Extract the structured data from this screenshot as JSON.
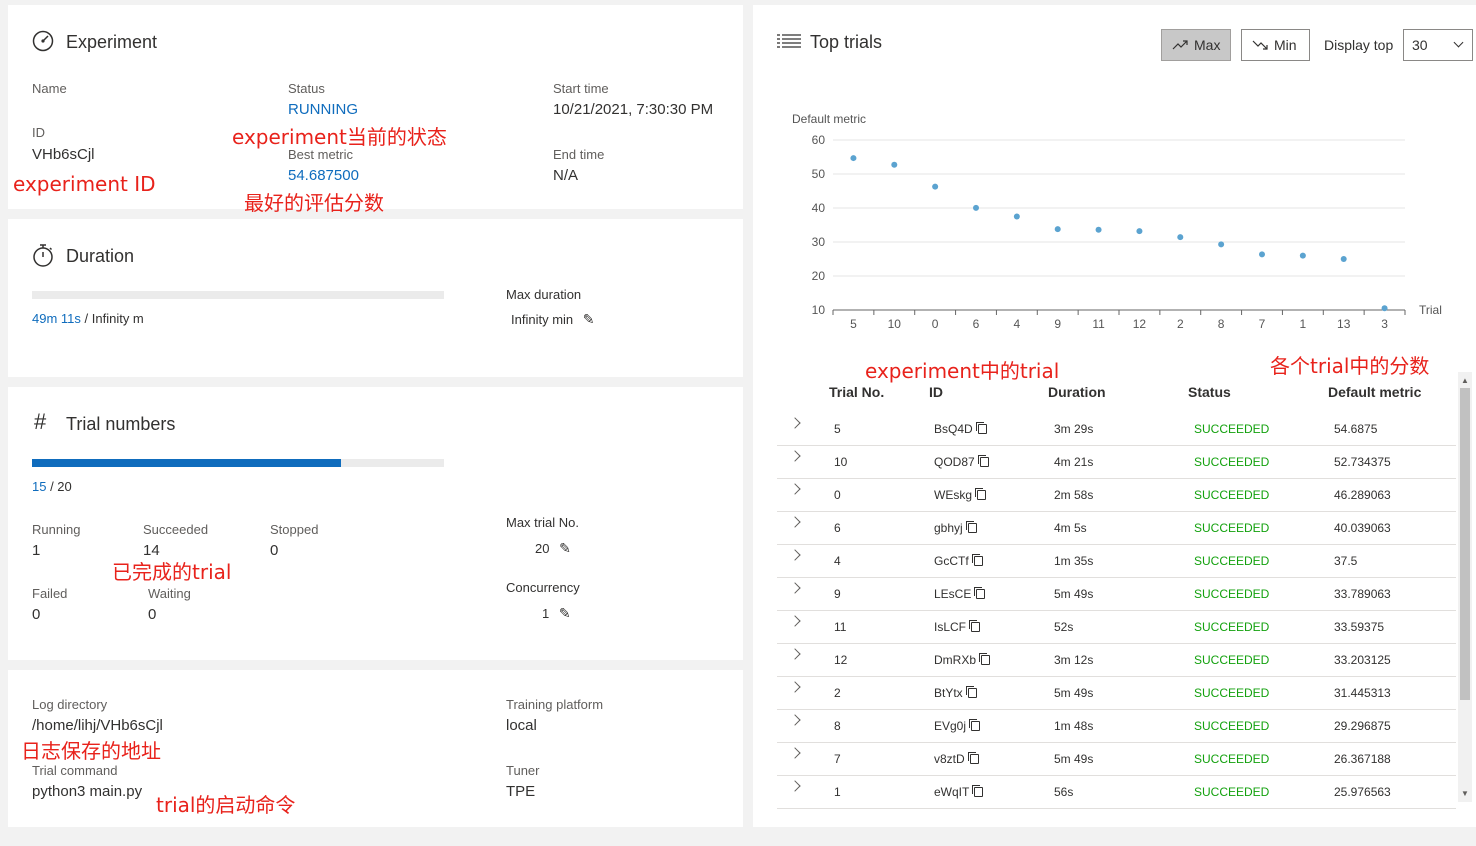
{
  "experiment": {
    "title": "Experiment",
    "name_label": "Name",
    "id_label": "ID",
    "id_value": "VHb6sCjl",
    "status_label": "Status",
    "status_value": "RUNNING",
    "best_metric_label": "Best metric",
    "best_metric_value": "54.687500",
    "start_time_label": "Start time",
    "start_time_value": "10/21/2021, 7:30:30 PM",
    "end_time_label": "End time",
    "end_time_value": "N/A"
  },
  "duration": {
    "title": "Duration",
    "elapsed": "49m 11s",
    "total": " / Infinity m",
    "progress_fraction": 0,
    "max_label": "Max duration",
    "max_value": "Infinity",
    "max_unit": "min"
  },
  "trial_numbers": {
    "title": "Trial numbers",
    "done": "15",
    "total": " / 20",
    "progress_fraction": 0.75,
    "running_label": "Running",
    "running_value": "1",
    "succeeded_label": "Succeeded",
    "succeeded_value": "14",
    "stopped_label": "Stopped",
    "stopped_value": "0",
    "failed_label": "Failed",
    "failed_value": "0",
    "waiting_label": "Waiting",
    "waiting_value": "0",
    "max_trial_label": "Max trial No.",
    "max_trial_value": "20",
    "concurrency_label": "Concurrency",
    "concurrency_value": "1"
  },
  "info": {
    "log_dir_label": "Log directory",
    "log_dir_value": "/home/lihj/VHb6sCjl",
    "trial_cmd_label": "Trial command",
    "trial_cmd_value": "python3 main.py",
    "platform_label": "Training platform",
    "platform_value": "local",
    "tuner_label": "Tuner",
    "tuner_value": "TPE"
  },
  "top_trials": {
    "title": "Top trials",
    "max_label": "Max",
    "min_label": "Min",
    "display_top_label": "Display top",
    "display_top_value": "30",
    "columns": [
      "Trial No.",
      "ID",
      "Duration",
      "Status",
      "Default metric"
    ],
    "rows": [
      {
        "no": "5",
        "id": "BsQ4D",
        "duration": "3m 29s",
        "status": "SUCCEEDED",
        "metric": "54.6875"
      },
      {
        "no": "10",
        "id": "QOD87",
        "duration": "4m 21s",
        "status": "SUCCEEDED",
        "metric": "52.734375"
      },
      {
        "no": "0",
        "id": "WEskg",
        "duration": "2m 58s",
        "status": "SUCCEEDED",
        "metric": "46.289063"
      },
      {
        "no": "6",
        "id": "gbhyj",
        "duration": "4m 5s",
        "status": "SUCCEEDED",
        "metric": "40.039063"
      },
      {
        "no": "4",
        "id": "GcCTf",
        "duration": "1m 35s",
        "status": "SUCCEEDED",
        "metric": "37.5"
      },
      {
        "no": "9",
        "id": "LEsCE",
        "duration": "5m 49s",
        "status": "SUCCEEDED",
        "metric": "33.789063"
      },
      {
        "no": "11",
        "id": "IsLCF",
        "duration": "52s",
        "status": "SUCCEEDED",
        "metric": "33.59375"
      },
      {
        "no": "12",
        "id": "DmRXb",
        "duration": "3m 12s",
        "status": "SUCCEEDED",
        "metric": "33.203125"
      },
      {
        "no": "2",
        "id": "BtYtx",
        "duration": "5m 49s",
        "status": "SUCCEEDED",
        "metric": "31.445313"
      },
      {
        "no": "8",
        "id": "EVg0j",
        "duration": "1m 48s",
        "status": "SUCCEEDED",
        "metric": "29.296875"
      },
      {
        "no": "7",
        "id": "v8ztD",
        "duration": "5m 49s",
        "status": "SUCCEEDED",
        "metric": "26.367188"
      },
      {
        "no": "1",
        "id": "eWqIT",
        "duration": "56s",
        "status": "SUCCEEDED",
        "metric": "25.976563"
      }
    ]
  },
  "chart_data": {
    "type": "scatter",
    "title": "",
    "ylabel": "Default metric",
    "xlabel": "Trial",
    "ylim": [
      10,
      60
    ],
    "yticks": [
      10,
      20,
      30,
      40,
      50,
      60
    ],
    "categories": [
      "5",
      "10",
      "0",
      "6",
      "4",
      "9",
      "11",
      "12",
      "2",
      "8",
      "7",
      "1",
      "13",
      "3"
    ],
    "values": [
      54.6875,
      52.734375,
      46.289063,
      40.039063,
      37.5,
      33.789063,
      33.59375,
      33.203125,
      31.445313,
      29.296875,
      26.367188,
      25.976563,
      25,
      10.5
    ],
    "point_color": "#5ba3d0",
    "grid": true
  },
  "annotations": {
    "status": "experiment当前的状态",
    "exp_id": "experiment ID",
    "best_metric": "最好的评估分数",
    "succeeded": "已完成的trial",
    "log_dir": "日志保存的地址",
    "trial_cmd": "trial的启动命令",
    "trials": "experiment中的trial",
    "metrics": "各个trial中的分数"
  },
  "colors": {
    "accent": "#0f6cbd",
    "success": "#13a10e",
    "annotation": "#e8221b"
  }
}
